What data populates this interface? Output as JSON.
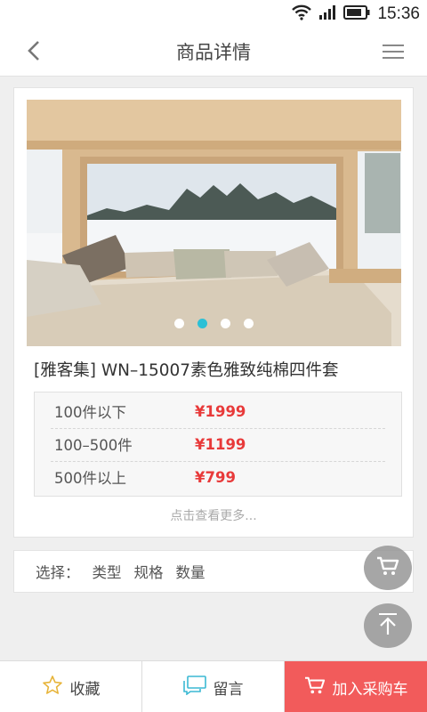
{
  "status_bar": {
    "time": "15:36"
  },
  "nav": {
    "title": "商品详情"
  },
  "product": {
    "title": "[雅客集] WN–15007素色雅致纯棉四件套",
    "carousel": {
      "count": 4,
      "active_index": 1
    },
    "prices": [
      {
        "qty": "100件以下",
        "price": "¥1999"
      },
      {
        "qty": "100–500件",
        "price": "¥1199"
      },
      {
        "qty": "500件以上",
        "price": "¥799"
      }
    ],
    "more_text": "点击查看更多..."
  },
  "selection": {
    "label": "选择：",
    "options": [
      "类型",
      "规格",
      "数量"
    ]
  },
  "bottom_bar": {
    "favorite_label": "收藏",
    "message_label": "留言",
    "add_to_cart_label": "加入采购车"
  },
  "colors": {
    "accent_red": "#f25b5b",
    "price_red": "#e83a3a",
    "dot_active": "#2cc0d6"
  },
  "icons": [
    "wifi-icon",
    "signal-icon",
    "battery-icon",
    "back-icon",
    "menu-icon",
    "cart-icon",
    "arrow-up-icon",
    "star-icon",
    "chat-icon"
  ]
}
